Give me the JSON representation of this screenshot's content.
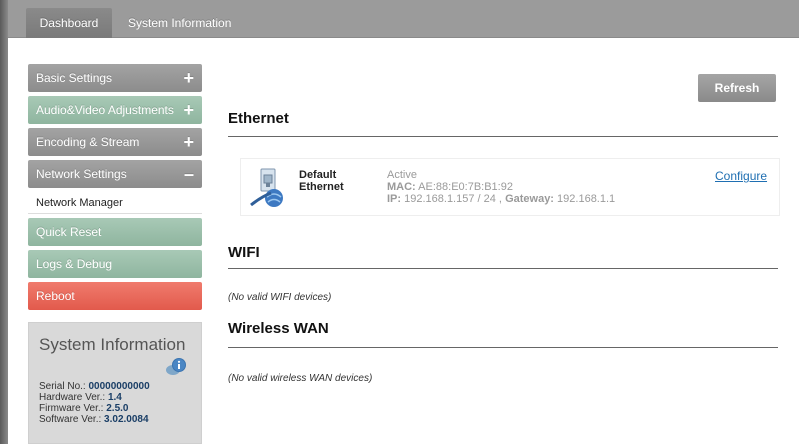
{
  "topnav": {
    "tabs": [
      {
        "label": "Dashboard"
      },
      {
        "label": "System Information"
      }
    ]
  },
  "sidebar": {
    "items": [
      {
        "label": "Basic Settings",
        "sign": "+"
      },
      {
        "label": "Audio&Video Adjustments",
        "sign": "+"
      },
      {
        "label": "Encoding & Stream",
        "sign": "+"
      },
      {
        "label": "Network Settings",
        "sign": "–"
      },
      {
        "label": "Network Manager"
      },
      {
        "label": "Quick Reset"
      },
      {
        "label": "Logs & Debug"
      },
      {
        "label": "Reboot"
      }
    ]
  },
  "sysinfo": {
    "title": "System Information",
    "serial_label": "Serial No.:",
    "serial_value": "00000000000",
    "hardware_label": "Hardware Ver.:",
    "hardware_value": "1.4",
    "firmware_label": "Firmware Ver.:",
    "firmware_value": "2.5.0",
    "software_label": "Software Ver.:",
    "software_value": "3.02.0084"
  },
  "main": {
    "refresh_label": "Refresh",
    "ethernet": {
      "title": "Ethernet",
      "name_line1": "Default",
      "name_line2": "Ethernet",
      "status": "Active",
      "mac_label": "MAC:",
      "mac_value": "AE:88:E0:7B:B1:92",
      "ip_label": "IP:",
      "ip_value": "192.168.1.157 / 24 ,",
      "gateway_label": "Gateway:",
      "gateway_value": "192.168.1.1",
      "configure_label": "Configure"
    },
    "wifi": {
      "title": "WIFI",
      "note": "(No valid WIFI devices)"
    },
    "wwan": {
      "title": "Wireless WAN",
      "note": "(No valid wireless WAN devices)"
    }
  },
  "colors": {
    "gray_button": "#8c8c8c",
    "green_button": "#8fb59f",
    "red_button": "#e25a4c",
    "link": "#1f6fb2"
  }
}
